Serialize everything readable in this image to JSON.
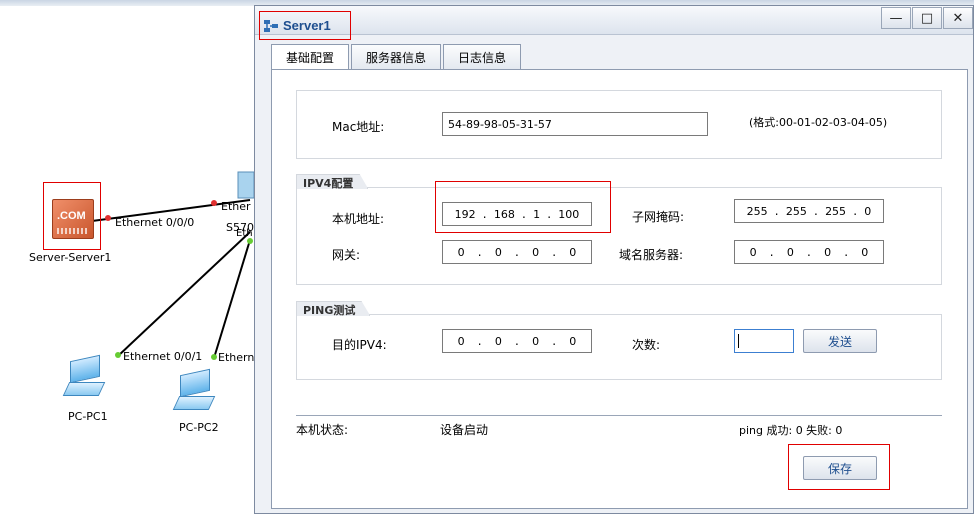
{
  "topology": {
    "server_label": "Server-Server1",
    "server_icon_text": ".COM",
    "switch_label_partial": "S570",
    "pc1_label": "PC-PC1",
    "pc2_label": "PC-PC2",
    "ports": {
      "server_port": "Ethernet 0/0/0",
      "switch_port_a": "Ether",
      "switch_port_b": "Eth",
      "pc1_port": "Ethernet 0/0/1",
      "pc2_port": "Ethernet"
    }
  },
  "window": {
    "title": "Server1",
    "minimize": "—",
    "maximize": "□",
    "close": "✕"
  },
  "tabs": [
    "基础配置",
    "服务器信息",
    "日志信息"
  ],
  "basic": {
    "mac_label": "Mac地址:",
    "mac_value": "54-89-98-05-31-57",
    "mac_hint": "(格式:00-01-02-03-04-05)"
  },
  "ipv4": {
    "group_title": "IPV4配置",
    "ip_label": "本机地址:",
    "ip": [
      "192",
      "168",
      "1",
      "100"
    ],
    "mask_label": "子网掩码:",
    "mask": [
      "255",
      "255",
      "255",
      "0"
    ],
    "gateway_label": "网关:",
    "gateway": [
      "0",
      "0",
      "0",
      "0"
    ],
    "dns_label": "域名服务器:",
    "dns": [
      "0",
      "0",
      "0",
      "0"
    ]
  },
  "ping": {
    "group_title": "PING测试",
    "target_label": "目的IPV4:",
    "target": [
      "0",
      "0",
      "0",
      "0"
    ],
    "count_label": "次数:",
    "count_value": "",
    "send_button": "发送"
  },
  "status": {
    "label": "本机状态:",
    "value": "设备启动",
    "ping_result": "ping 成功: 0 失败: 0"
  },
  "save_button": "保存",
  "colors": {
    "highlight_red": "#e00000",
    "title_blue": "#1f4f8f",
    "link_green": "#66cc33",
    "link_red": "#e03030"
  }
}
